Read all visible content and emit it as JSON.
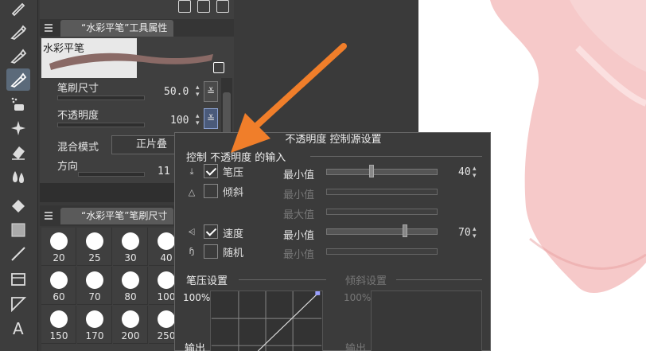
{
  "tool_panel": {
    "tab_title": "“水彩平笔”工具属性",
    "brush_name": "水彩平笔",
    "brush_size_label": "笔刷尺寸",
    "brush_size_value": "50.0",
    "opacity_label": "不透明度",
    "opacity_value": "100",
    "blend_label": "混合模式",
    "blend_value": "正片叠",
    "direction_label": "方向",
    "direction_value": "11"
  },
  "size_panel": {
    "tab_title": "“水彩平笔”笔刷尺寸",
    "sizes": [
      "20",
      "25",
      "30",
      "40",
      "60",
      "70",
      "80",
      "100",
      "150",
      "170",
      "200",
      "250"
    ]
  },
  "popup": {
    "title": "不透明度 控制源设置",
    "section_input": "控制 不透明度 的输入",
    "rows": [
      {
        "name": "笔压",
        "checked": true,
        "slider_label": "最小值",
        "value": "40",
        "enabled": true,
        "knob": 0.4
      },
      {
        "name": "倾斜",
        "checked": false,
        "slider_label": "最小值",
        "value": "",
        "enabled": false,
        "knob": null
      },
      {
        "name": "",
        "checked": false,
        "slider_label": "最大值",
        "value": "",
        "enabled": false,
        "knob": null
      },
      {
        "name": "速度",
        "checked": true,
        "slider_label": "最小值",
        "value": "70",
        "enabled": true,
        "knob": 0.7
      },
      {
        "name": "随机",
        "checked": false,
        "slider_label": "最小值",
        "value": "",
        "enabled": false,
        "knob": null
      }
    ],
    "pressure_title": "笔压设置",
    "tilt_title": "倾斜设置",
    "axis_max": "100%",
    "axis_out": "输出",
    "tilt_axis_max": "100%",
    "tilt_axis_out": "输出"
  },
  "colors": {
    "accent": "#f07e2a",
    "selected_tool": "#5b6a7a",
    "canvas_pink": "#f2b8b8"
  },
  "icons": [
    "pen-icon",
    "pen-icon",
    "pen-icon",
    "pen-icon",
    "airbrush-icon",
    "sparkle-icon",
    "eraser-icon",
    "blend-icon",
    "fill-icon",
    "gradient-icon",
    "line-icon",
    "frame-icon",
    "ruler-icon",
    "text-icon"
  ]
}
